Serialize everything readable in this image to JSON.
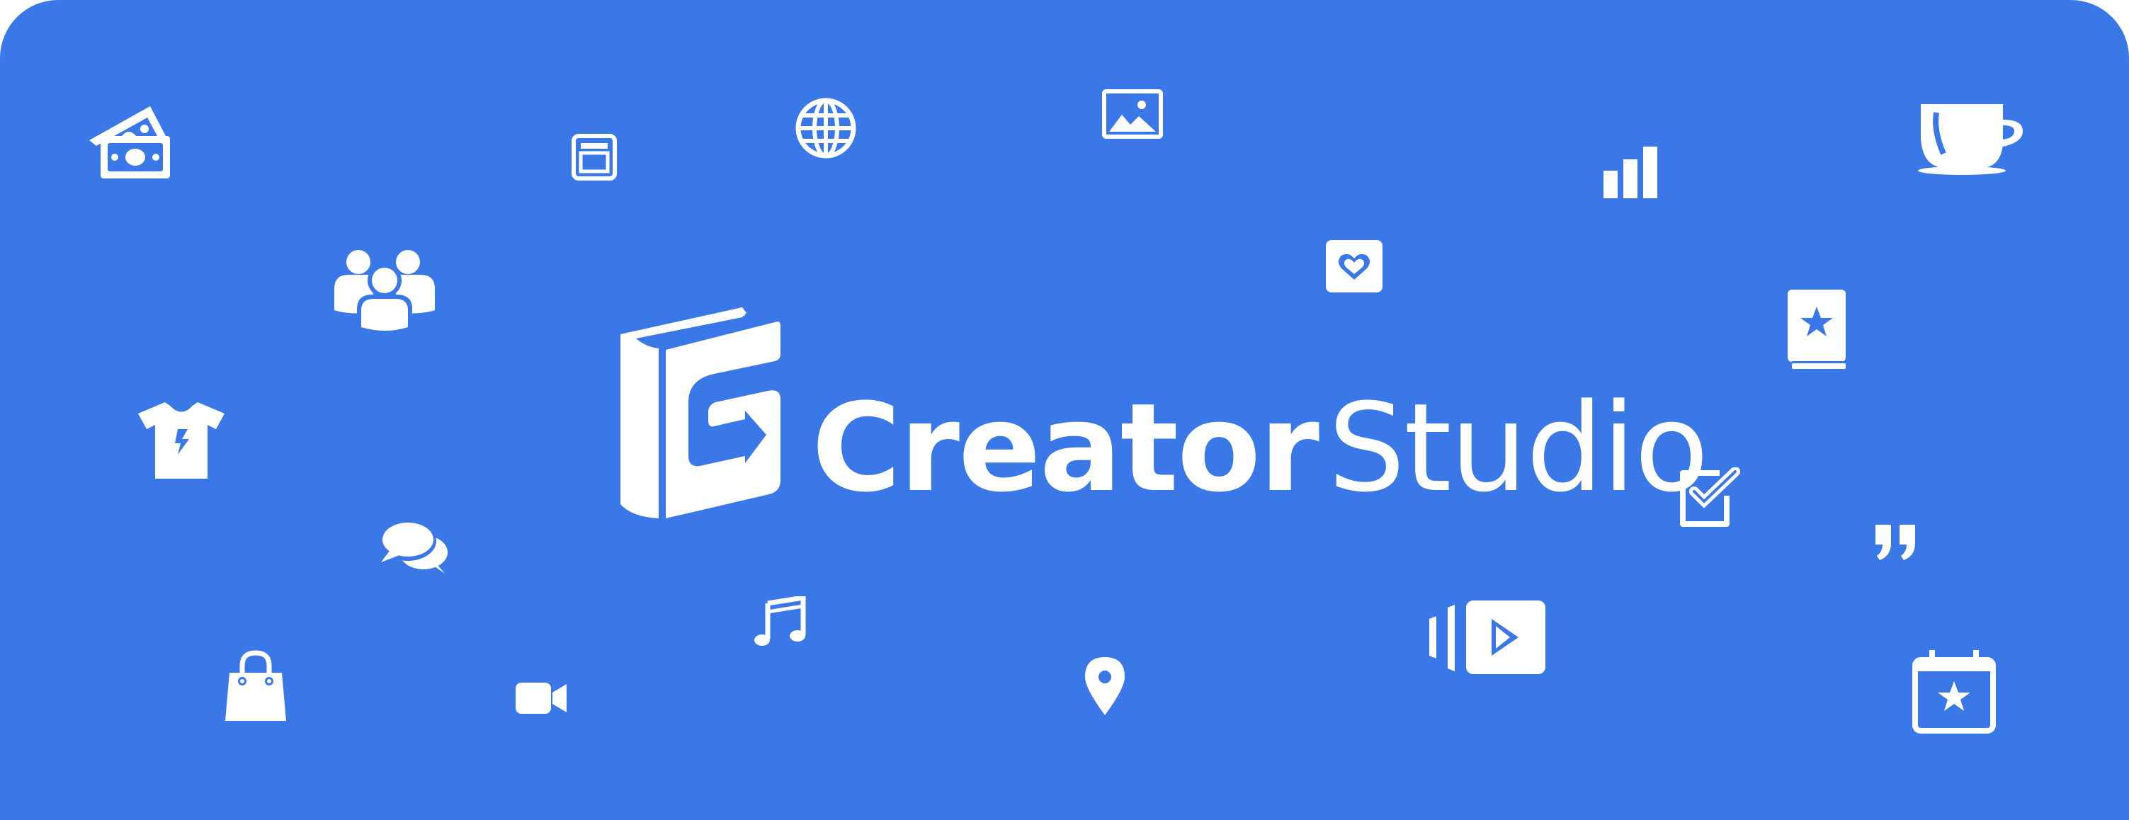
{
  "brand": {
    "name_part_1": "Creator",
    "name_part_2": "Studio"
  },
  "colors": {
    "background": "#3a78e7",
    "foreground": "#ffffff"
  },
  "icons": [
    "money-icon",
    "browser-window-icon",
    "globe-icon",
    "image-icon",
    "bar-chart-icon",
    "coffee-cup-icon",
    "people-group-icon",
    "heart-card-icon",
    "star-book-icon",
    "t-shirt-icon",
    "checkbox-icon",
    "quote-icon",
    "chat-bubbles-icon",
    "music-note-icon",
    "video-play-icon",
    "shopping-bag-icon",
    "video-camera-icon",
    "location-pin-icon",
    "calendar-star-icon"
  ]
}
